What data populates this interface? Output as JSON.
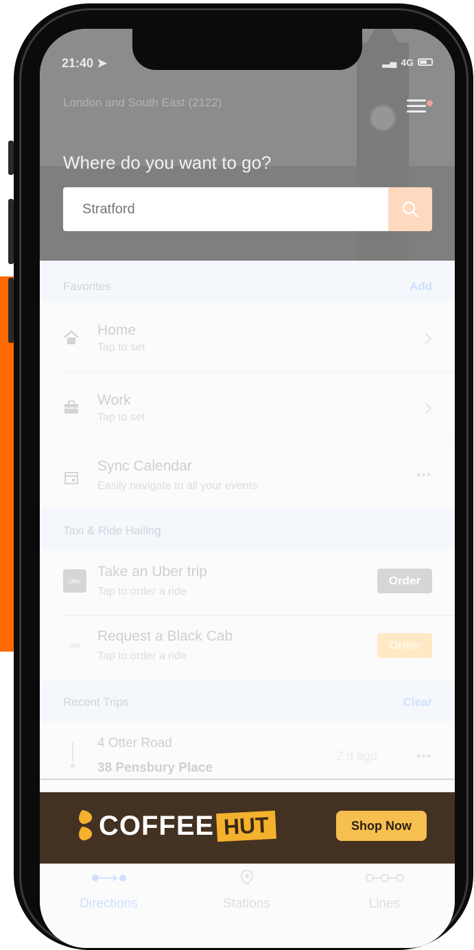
{
  "status": {
    "time": "21:40",
    "network": "4G"
  },
  "header": {
    "region": "London and South East (2122)",
    "prompt": "Where do you want to go?",
    "search_placeholder": "Stratford"
  },
  "favorites": {
    "title": "Favorites",
    "action": "Add",
    "items": [
      {
        "title": "Home",
        "subtitle": "Tap to set"
      },
      {
        "title": "Work",
        "subtitle": "Tap to set"
      },
      {
        "title": "Sync Calendar",
        "subtitle": "Easily navigate to all your events"
      }
    ]
  },
  "taxi": {
    "title": "Taxi & Ride Hailing",
    "items": [
      {
        "logo": "Uber",
        "title": "Take an Uber trip",
        "subtitle": "Tap to order a ride",
        "button": "Order"
      },
      {
        "logo": "Gett",
        "title": "Request a Black Cab",
        "subtitle": "Tap to order a ride",
        "button": "Order"
      }
    ]
  },
  "recent": {
    "title": "Recent Trips",
    "action": "Clear",
    "items": [
      {
        "from": "4 Otter Road",
        "to": "38 Pensbury Place",
        "time": "2 d ago"
      }
    ]
  },
  "ad": {
    "brand_a": "COFFEE",
    "brand_b": "HUT",
    "cta": "Shop Now"
  },
  "tabs": [
    {
      "label": "Directions",
      "active": true
    },
    {
      "label": "Stations",
      "active": false
    },
    {
      "label": "Lines",
      "active": false
    }
  ],
  "colors": {
    "accent_orange": "#ff6a00",
    "active_tab": "#cfe0ff",
    "ad_background": "#433122",
    "ad_button": "#f6bf4f"
  }
}
